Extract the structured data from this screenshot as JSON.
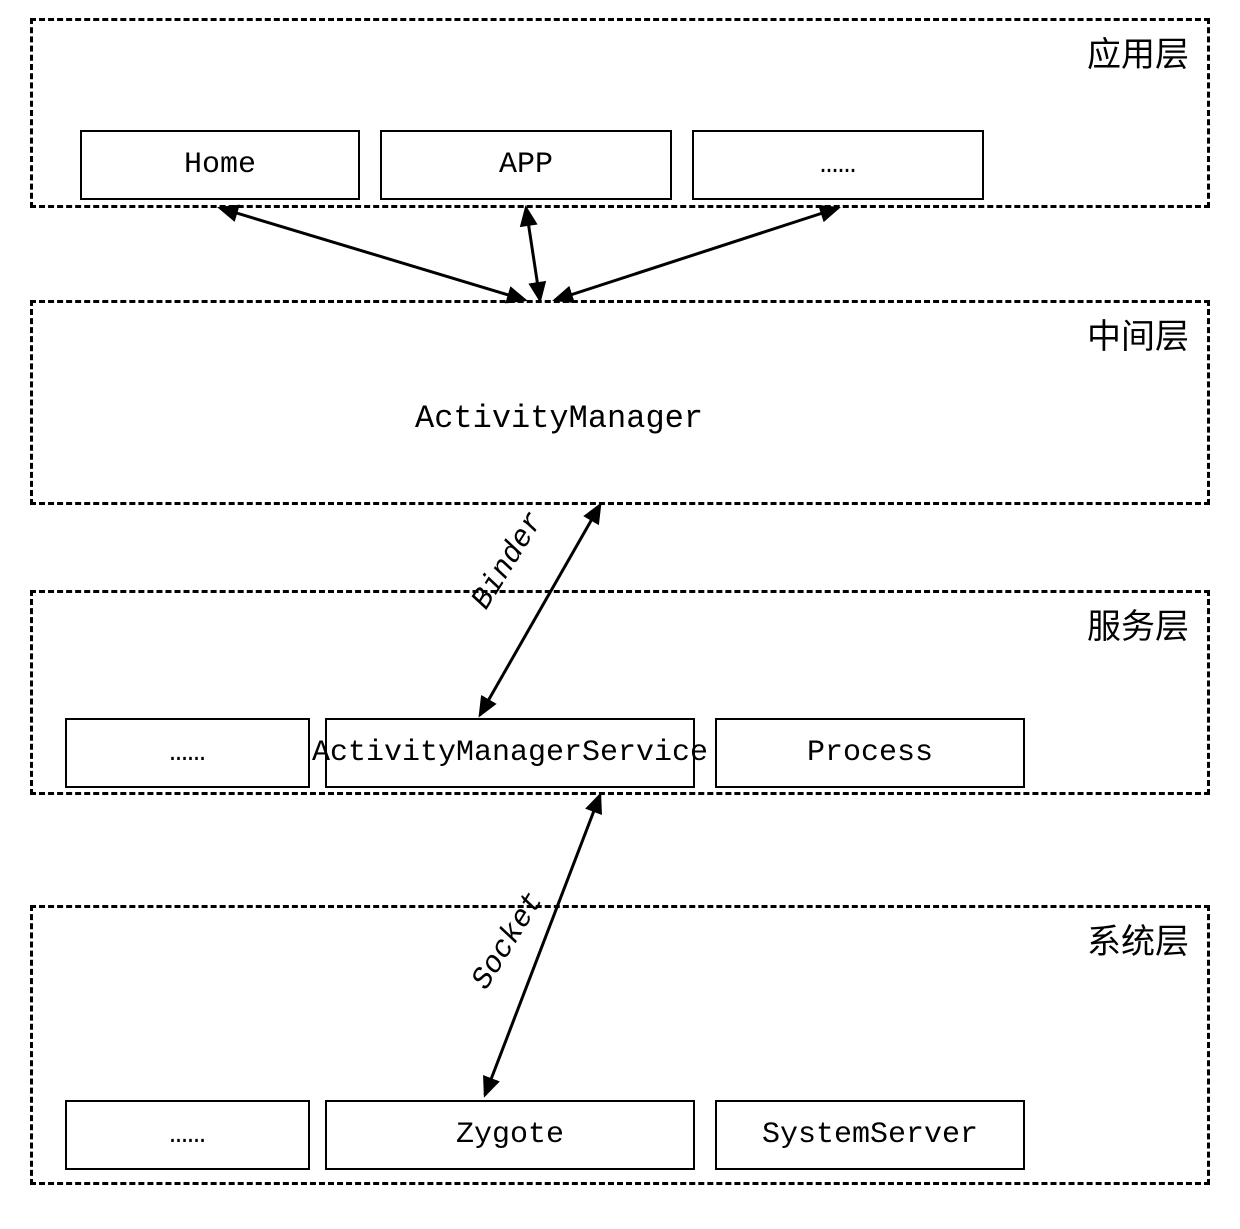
{
  "layers": {
    "app": {
      "label": "应用层",
      "boxes": [
        "Home",
        "APP",
        "……"
      ]
    },
    "middle": {
      "label": "中间层",
      "component": "ActivityManager"
    },
    "service": {
      "label": "服务层",
      "boxes": [
        "……",
        "ActivityManagerService",
        "Process"
      ]
    },
    "system": {
      "label": "系统层",
      "boxes": [
        "……",
        "Zygote",
        "SystemServer"
      ]
    }
  },
  "connections": {
    "middle_to_service": "Binder",
    "service_to_system": "Socket"
  }
}
